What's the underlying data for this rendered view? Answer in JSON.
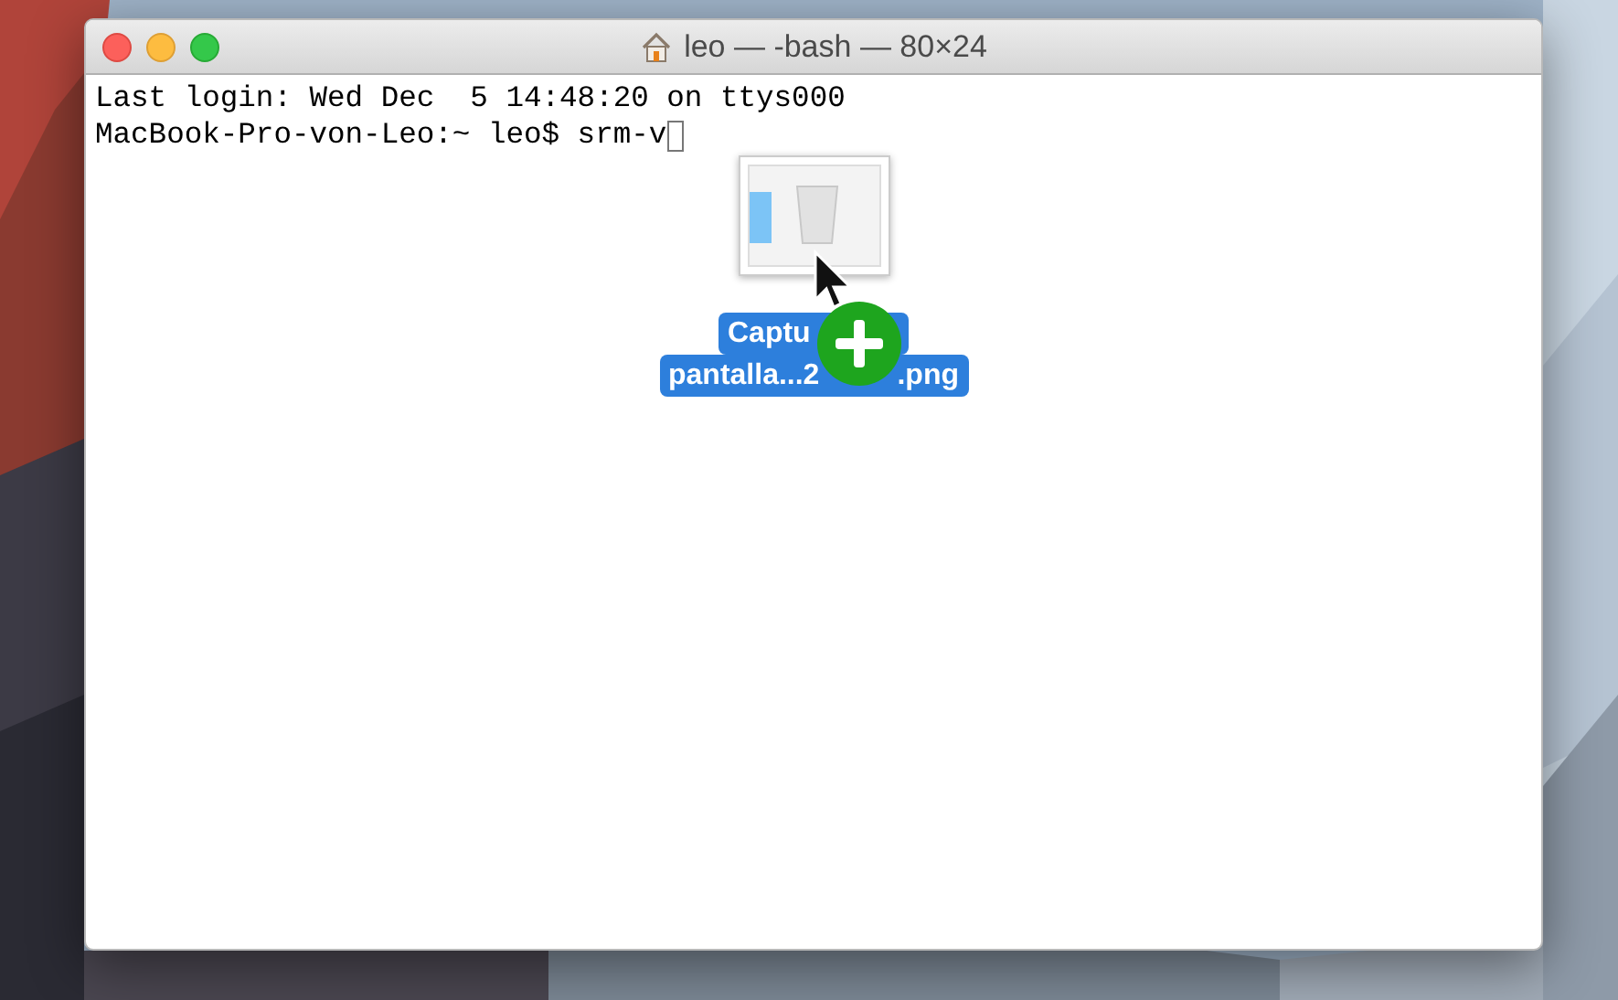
{
  "window": {
    "title": "leo — -bash — 80×24"
  },
  "terminal": {
    "lines": [
      {
        "text": "Last login: Wed Dec  5 14:48:20 on ttys000",
        "cursor": false
      },
      {
        "text": "MacBook-Pro-von-Leo:~ leo$ srm-v",
        "cursor": true
      }
    ]
  },
  "drag_item": {
    "label_lines": [
      {
        "start": "Captu"
      },
      {
        "start": "pantalla...2",
        "end": ".png"
      }
    ]
  }
}
